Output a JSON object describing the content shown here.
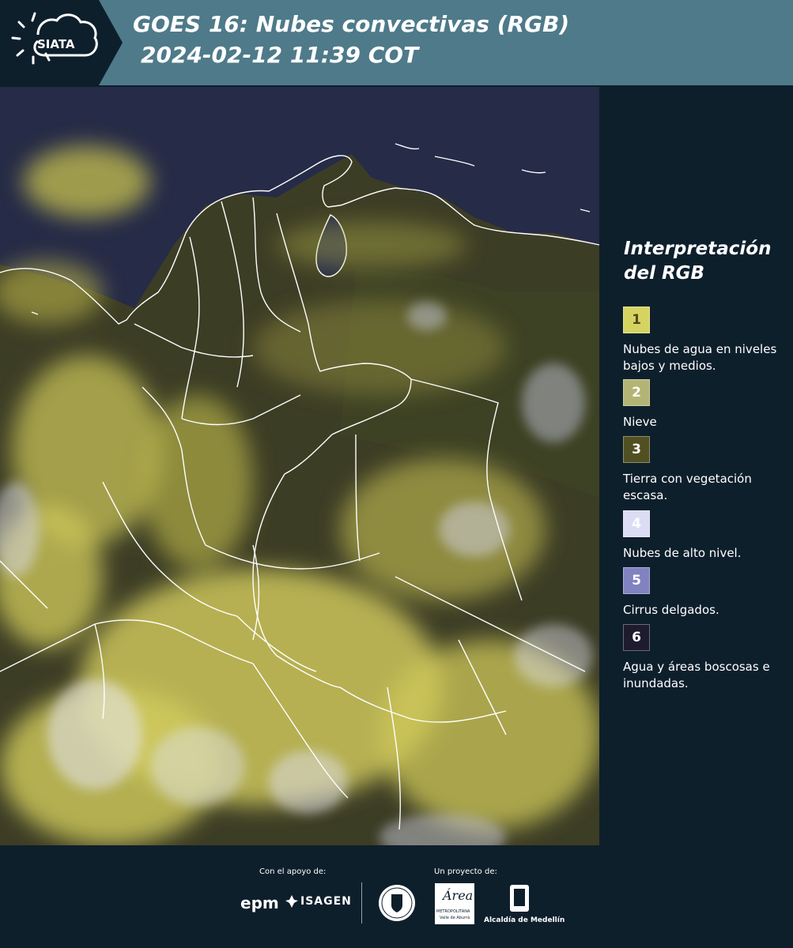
{
  "header": {
    "brand": "SIATA",
    "title_line1": "GOES 16: Nubes convectivas (RGB)",
    "title_line2": "2024-02-12 11:39 COT",
    "background_color": "#4e7a8a"
  },
  "legend": {
    "title": "Interpretación del RGB",
    "items": [
      {
        "number": "1",
        "description": "Nubes de agua en niveles bajos y medios.",
        "color": "#d6d460"
      },
      {
        "number": "2",
        "description": "Nieve",
        "color": "#b3b474"
      },
      {
        "number": "3",
        "description": "Tierra con vegetación escasa.",
        "color": "#515022"
      },
      {
        "number": "4",
        "description": "Nubes de alto nivel.",
        "color": "#dcdcf4"
      },
      {
        "number": "5",
        "description": "Cirrus delgados.",
        "color": "#8182c0"
      },
      {
        "number": "6",
        "description": "Agua y áreas boscosas e inundadas.",
        "color": "#1d1b2d"
      }
    ]
  },
  "footer": {
    "support_label": "Con el apoyo de:",
    "project_label": "Un proyecto de:",
    "logos": {
      "epm": "epm",
      "isagen": "ISAGEN",
      "metropolitana": "Área",
      "metropolitana_sub": "METROPOLITANA",
      "metropolitana_sub2": "Valle de Aburrá",
      "alcaldia": "Alcaldía de Medellín",
      "medellin_seal": "MEDELLÍN"
    }
  }
}
